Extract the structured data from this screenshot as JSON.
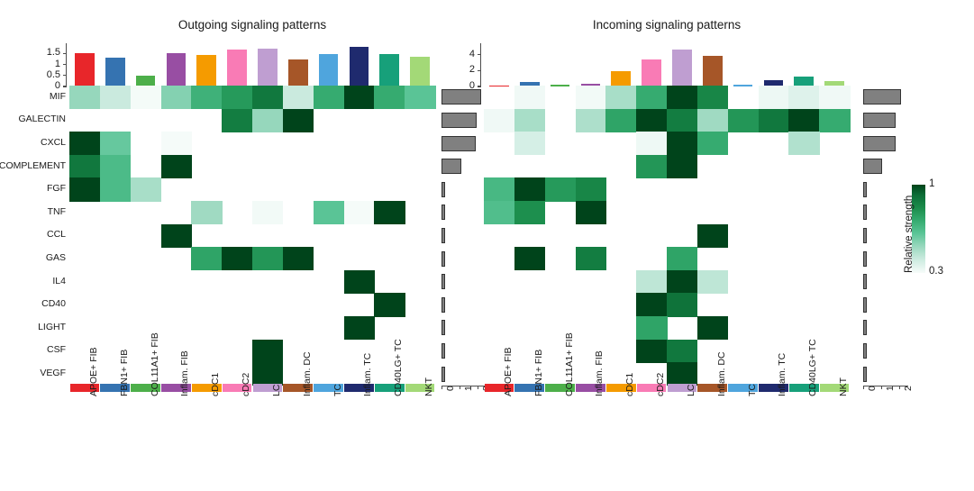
{
  "figure": {
    "legend": {
      "title": "Relative strength",
      "max_label": "1",
      "min_label": "0.3",
      "color_high": "#00441b",
      "color_low": "#f7fcfa"
    }
  },
  "cell_types": [
    {
      "label": "APOE+ FIB",
      "color": "#e8262a"
    },
    {
      "label": "FBN1+ FIB",
      "color": "#3573b1"
    },
    {
      "label": "COL11A1+ FIB",
      "color": "#4daf4a"
    },
    {
      "label": "Inflam. FIB",
      "color": "#984ea3"
    },
    {
      "label": "cDC1",
      "color": "#f59b00"
    },
    {
      "label": "cDC2",
      "color": "#f97bb5"
    },
    {
      "label": "LC",
      "color": "#bf9ed1"
    },
    {
      "label": "Inflam. DC",
      "color": "#a65628"
    },
    {
      "label": "TC",
      "color": "#4fa5dd"
    },
    {
      "label": "Inflam. TC",
      "color": "#1f2a6e"
    },
    {
      "label": "CD40LG+ TC",
      "color": "#17a07a"
    },
    {
      "label": "NKT",
      "color": "#a3d977"
    }
  ],
  "pathways": [
    "MIF",
    "GALECTIN",
    "CXCL",
    "COMPLEMENT",
    "FGF",
    "TNF",
    "CCL",
    "GAS",
    "IL4",
    "CD40",
    "LIGHT",
    "CSF",
    "VEGF"
  ],
  "chart_data": [
    {
      "type": "heatmap",
      "title": "Outgoing signaling patterns",
      "xlabel": "",
      "ylabel": "",
      "grid": false,
      "legend_position": "right",
      "categories": [
        "APOE+ FIB",
        "FBN1+ FIB",
        "COL11A1+ FIB",
        "Inflam. FIB",
        "cDC1",
        "cDC2",
        "LC",
        "Inflam. DC",
        "TC",
        "Inflam. TC",
        "CD40LG+ TC",
        "NKT"
      ],
      "rows": [
        "MIF",
        "GALECTIN",
        "CXCL",
        "COMPLEMENT",
        "FGF",
        "TNF",
        "CCL",
        "GAS",
        "IL4",
        "CD40",
        "LIGHT",
        "CSF",
        "VEGF"
      ],
      "values": [
        [
          0.62,
          0.5,
          0.32,
          0.65,
          0.78,
          0.85,
          0.93,
          0.5,
          0.8,
          1.0,
          0.8,
          0.72
        ],
        [
          null,
          null,
          null,
          null,
          null,
          0.92,
          0.62,
          1.0,
          null,
          null,
          null,
          null
        ],
        [
          1.0,
          0.7,
          null,
          0.31,
          null,
          null,
          null,
          null,
          null,
          null,
          null,
          null
        ],
        [
          0.93,
          0.75,
          null,
          1.0,
          null,
          null,
          null,
          null,
          null,
          null,
          null,
          null
        ],
        [
          1.0,
          0.75,
          0.58,
          null,
          null,
          null,
          null,
          null,
          null,
          null,
          null,
          null
        ],
        [
          null,
          null,
          null,
          null,
          0.6,
          null,
          0.33,
          null,
          0.72,
          0.31,
          1.0,
          null
        ],
        [
          null,
          null,
          null,
          1.0,
          null,
          null,
          null,
          null,
          null,
          null,
          null,
          null
        ],
        [
          null,
          null,
          null,
          null,
          0.82,
          1.0,
          0.86,
          1.0,
          null,
          null,
          null,
          null
        ],
        [
          null,
          null,
          null,
          null,
          null,
          null,
          null,
          null,
          null,
          1.0,
          null,
          null
        ],
        [
          null,
          null,
          null,
          null,
          null,
          null,
          null,
          null,
          null,
          null,
          1.0,
          null
        ],
        [
          null,
          null,
          null,
          null,
          null,
          null,
          null,
          null,
          null,
          1.0,
          null,
          null
        ],
        [
          null,
          null,
          null,
          null,
          null,
          null,
          1.0,
          null,
          null,
          null,
          null,
          null
        ],
        [
          null,
          null,
          null,
          null,
          null,
          null,
          1.0,
          null,
          null,
          null,
          null,
          null
        ]
      ],
      "top_bar": {
        "ylabel": "",
        "ylim": [
          0,
          1.8
        ],
        "ticks": [
          "0",
          "0.5",
          "1",
          "1.5"
        ],
        "values": [
          1.53,
          1.32,
          0.48,
          1.53,
          1.45,
          1.67,
          1.72,
          1.22,
          1.47,
          1.78,
          1.48,
          1.33
        ]
      },
      "right_bar": {
        "xlabel": "",
        "xlim": [
          0,
          2.4
        ],
        "ticks": [
          "0",
          "1",
          "2"
        ],
        "values": [
          2.18,
          1.96,
          1.92,
          1.1,
          0.22,
          0.22,
          0.22,
          0.22,
          0.2,
          0.2,
          0.2,
          0.2,
          0.2
        ]
      }
    },
    {
      "type": "heatmap",
      "title": "Incoming signaling patterns",
      "xlabel": "",
      "ylabel": "",
      "grid": false,
      "legend_position": "right",
      "categories": [
        "APOE+ FIB",
        "FBN1+ FIB",
        "COL11A1+ FIB",
        "Inflam. FIB",
        "cDC1",
        "cDC2",
        "LC",
        "Inflam. DC",
        "TC",
        "Inflam. TC",
        "CD40LG+ TC",
        "NKT"
      ],
      "rows": [
        "MIF",
        "GALECTIN",
        "CXCL",
        "COMPLEMENT",
        "FGF",
        "TNF",
        "CCL",
        "GAS",
        "IL4",
        "CD40",
        "LIGHT",
        "CSF",
        "VEGF"
      ],
      "values": [
        [
          null,
          0.34,
          null,
          0.33,
          0.58,
          0.8,
          1.0,
          0.9,
          null,
          0.36,
          0.43,
          0.34
        ],
        [
          0.34,
          0.58,
          null,
          0.57,
          0.82,
          1.0,
          0.92,
          0.6,
          0.86,
          0.93,
          1.0,
          0.8
        ],
        [
          null,
          0.46,
          null,
          null,
          null,
          0.35,
          1.0,
          0.8,
          null,
          null,
          0.56,
          null
        ],
        [
          null,
          null,
          null,
          null,
          null,
          0.86,
          1.0,
          null,
          null,
          null,
          null,
          null
        ],
        [
          0.76,
          1.0,
          0.85,
          0.9,
          null,
          null,
          null,
          null,
          null,
          null,
          null,
          null
        ],
        [
          0.74,
          0.88,
          null,
          1.0,
          null,
          null,
          null,
          null,
          null,
          null,
          null,
          null
        ],
        [
          null,
          null,
          null,
          null,
          null,
          null,
          null,
          1.0,
          null,
          null,
          null,
          null
        ],
        [
          null,
          1.0,
          null,
          0.92,
          null,
          null,
          0.82,
          null,
          null,
          null,
          null,
          null
        ],
        [
          null,
          null,
          null,
          null,
          null,
          0.53,
          1.0,
          0.53,
          null,
          null,
          null,
          null
        ],
        [
          null,
          null,
          null,
          null,
          null,
          1.0,
          0.94,
          null,
          null,
          null,
          null,
          null
        ],
        [
          null,
          null,
          null,
          null,
          null,
          0.82,
          null,
          1.0,
          null,
          null,
          null,
          null
        ],
        [
          null,
          null,
          null,
          null,
          null,
          1.0,
          0.93,
          null,
          null,
          null,
          null,
          null
        ],
        [
          null,
          null,
          null,
          null,
          null,
          null,
          1.0,
          null,
          null,
          null,
          null,
          null
        ]
      ],
      "top_bar": {
        "ylabel": "",
        "ylim": [
          0,
          5.0
        ],
        "ticks": [
          "0",
          "2",
          "4"
        ],
        "values": [
          0.08,
          0.55,
          0.18,
          0.35,
          1.95,
          3.4,
          4.7,
          3.85,
          0.22,
          0.85,
          1.25,
          0.7
        ]
      },
      "right_bar": {
        "xlabel": "",
        "xlim": [
          0,
          2.4
        ],
        "ticks": [
          "0",
          "1",
          "2"
        ],
        "values": [
          2.1,
          1.8,
          1.78,
          1.05,
          0.22,
          0.22,
          0.22,
          0.22,
          0.2,
          0.2,
          0.2,
          0.2,
          0.18
        ]
      }
    }
  ]
}
